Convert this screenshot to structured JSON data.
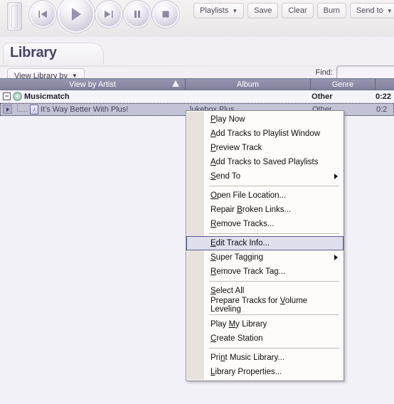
{
  "player": {
    "volume_slider_name": "volume-slider",
    "buttons": [
      {
        "name": "previous-track-button",
        "glyph": "previous-icon"
      },
      {
        "name": "play-button",
        "glyph": "play-icon"
      },
      {
        "name": "next-track-button",
        "glyph": "next-icon"
      },
      {
        "name": "pause-button",
        "glyph": "pause-icon"
      },
      {
        "name": "stop-button",
        "glyph": "stop-icon"
      }
    ]
  },
  "toolbar": {
    "playlists_label": "Playlists",
    "save_label": "Save",
    "clear_label": "Clear",
    "burn_label": "Burn",
    "send_to_label": "Send to",
    "caret": "▼",
    "clipped_label": ""
  },
  "library": {
    "title": "Library",
    "view_by_label": "View Library by",
    "view_by_caret": "▼",
    "find_label": "Find:",
    "find_value": "",
    "find_placeholder": ""
  },
  "tracklist": {
    "columns": [
      {
        "label": "View by Artist",
        "sort": "ascending"
      },
      {
        "label": "Album",
        "sort": ""
      },
      {
        "label": "Genre",
        "sort": ""
      },
      {
        "label": "",
        "sort": ""
      }
    ],
    "rows": [
      {
        "type": "group",
        "artist": "Musicmatch",
        "album": "",
        "genre": "Other",
        "time": "0:22",
        "expander": "−",
        "selected": false
      },
      {
        "type": "track",
        "artist": "It's Way Better With Plus!",
        "album": "Jukebox Plus",
        "genre": "Other",
        "time": "0:2",
        "expander": "",
        "selected": true
      }
    ]
  },
  "context_menu": {
    "items": [
      {
        "pre": "",
        "acc": "P",
        "post": "lay Now",
        "type": "item",
        "submenu": false,
        "highlighted": false
      },
      {
        "pre": "",
        "acc": "A",
        "post": "dd Tracks to Playlist Window",
        "type": "item",
        "submenu": false,
        "highlighted": false
      },
      {
        "pre": "",
        "acc": "P",
        "post": "review Track",
        "type": "item",
        "submenu": false,
        "highlighted": false
      },
      {
        "pre": "",
        "acc": "A",
        "post": "dd Tracks to Saved Playlists",
        "type": "item",
        "submenu": false,
        "highlighted": false
      },
      {
        "pre": "",
        "acc": "S",
        "post": "end To",
        "type": "item",
        "submenu": true,
        "highlighted": false
      },
      {
        "type": "separator"
      },
      {
        "pre": "",
        "acc": "O",
        "post": "pen File Location...",
        "type": "item",
        "submenu": false,
        "highlighted": false
      },
      {
        "pre": "Repair ",
        "acc": "B",
        "post": "roken Links...",
        "type": "item",
        "submenu": false,
        "highlighted": false
      },
      {
        "pre": "",
        "acc": "R",
        "post": "emove Tracks...",
        "type": "item",
        "submenu": false,
        "highlighted": false
      },
      {
        "type": "separator"
      },
      {
        "pre": "",
        "acc": "E",
        "post": "dit Track Info...",
        "type": "item",
        "submenu": false,
        "highlighted": true
      },
      {
        "pre": "",
        "acc": "S",
        "post": "uper Tagging",
        "type": "item",
        "submenu": true,
        "highlighted": false
      },
      {
        "pre": "",
        "acc": "R",
        "post": "emove Track Tag...",
        "type": "item",
        "submenu": false,
        "highlighted": false
      },
      {
        "type": "separator"
      },
      {
        "pre": "",
        "acc": "S",
        "post": "elect All",
        "type": "item",
        "submenu": false,
        "highlighted": false
      },
      {
        "pre": "Prepare Tracks for ",
        "acc": "V",
        "post": "olume Leveling",
        "type": "item",
        "submenu": false,
        "highlighted": false
      },
      {
        "type": "separator"
      },
      {
        "pre": "Play ",
        "acc": "M",
        "post": "y Library",
        "type": "item",
        "submenu": false,
        "highlighted": false
      },
      {
        "pre": "",
        "acc": "C",
        "post": "reate Station",
        "type": "item",
        "submenu": false,
        "highlighted": false
      },
      {
        "type": "separator"
      },
      {
        "pre": "Pri",
        "acc": "n",
        "post": "t Music Library...",
        "type": "item",
        "submenu": false,
        "highlighted": false
      },
      {
        "pre": "",
        "acc": "L",
        "post": "ibrary Properties...",
        "type": "item",
        "submenu": false,
        "highlighted": false
      }
    ]
  },
  "colors": {
    "header_bar": "#8b8ba6",
    "selection": "#c3c3d6",
    "menu_highlight_border": "#5a5a90",
    "menu_gutter": "#e8e2dd",
    "title_text": "#4a4466"
  }
}
